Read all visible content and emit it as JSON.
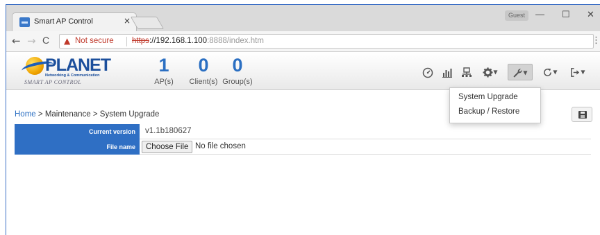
{
  "browser": {
    "tab_title": "Smart AP Control",
    "tab_close": "×",
    "guest_label": "Guest",
    "window_controls": {
      "minimize": "—",
      "maximize": "☐",
      "close": "✕"
    },
    "nav": {
      "back": "←",
      "forward": "→",
      "reload": "C"
    },
    "security_label": "Not secure",
    "url": {
      "scheme": "https",
      "host": "://192.168.1.100",
      "path": ":8888/index.htm"
    },
    "menu_icon": "⋮"
  },
  "app": {
    "logo": {
      "brand": "PLANET",
      "tagline": "Networking & Communication",
      "product": "SMART AP CONTROL"
    },
    "stats": [
      {
        "value": "1",
        "label": "AP(s)"
      },
      {
        "value": "0",
        "label": "Client(s)"
      },
      {
        "value": "0",
        "label": "Group(s)"
      }
    ],
    "toolbar": [
      {
        "icon": "dashboard-icon"
      },
      {
        "icon": "bar-chart-icon"
      },
      {
        "icon": "network-icon"
      },
      {
        "icon": "gear-icon",
        "has_dropdown": true
      },
      {
        "icon": "wrench-icon",
        "has_dropdown": true,
        "active": true
      },
      {
        "icon": "refresh-icon",
        "has_dropdown": true
      },
      {
        "icon": "logout-icon",
        "has_dropdown": true
      }
    ],
    "maintenance_menu": [
      "System Upgrade",
      "Backup / Restore"
    ]
  },
  "page": {
    "breadcrumb": {
      "home": "Home",
      "sep1": ">",
      "section": "Maintenance",
      "sep2": ">",
      "current": "System Upgrade"
    },
    "form": {
      "current_version_label": "Current version",
      "current_version_value": "v1.1b180627",
      "file_name_label": "File name",
      "choose_file_button": "Choose File",
      "no_file_text": "No file chosen"
    }
  }
}
